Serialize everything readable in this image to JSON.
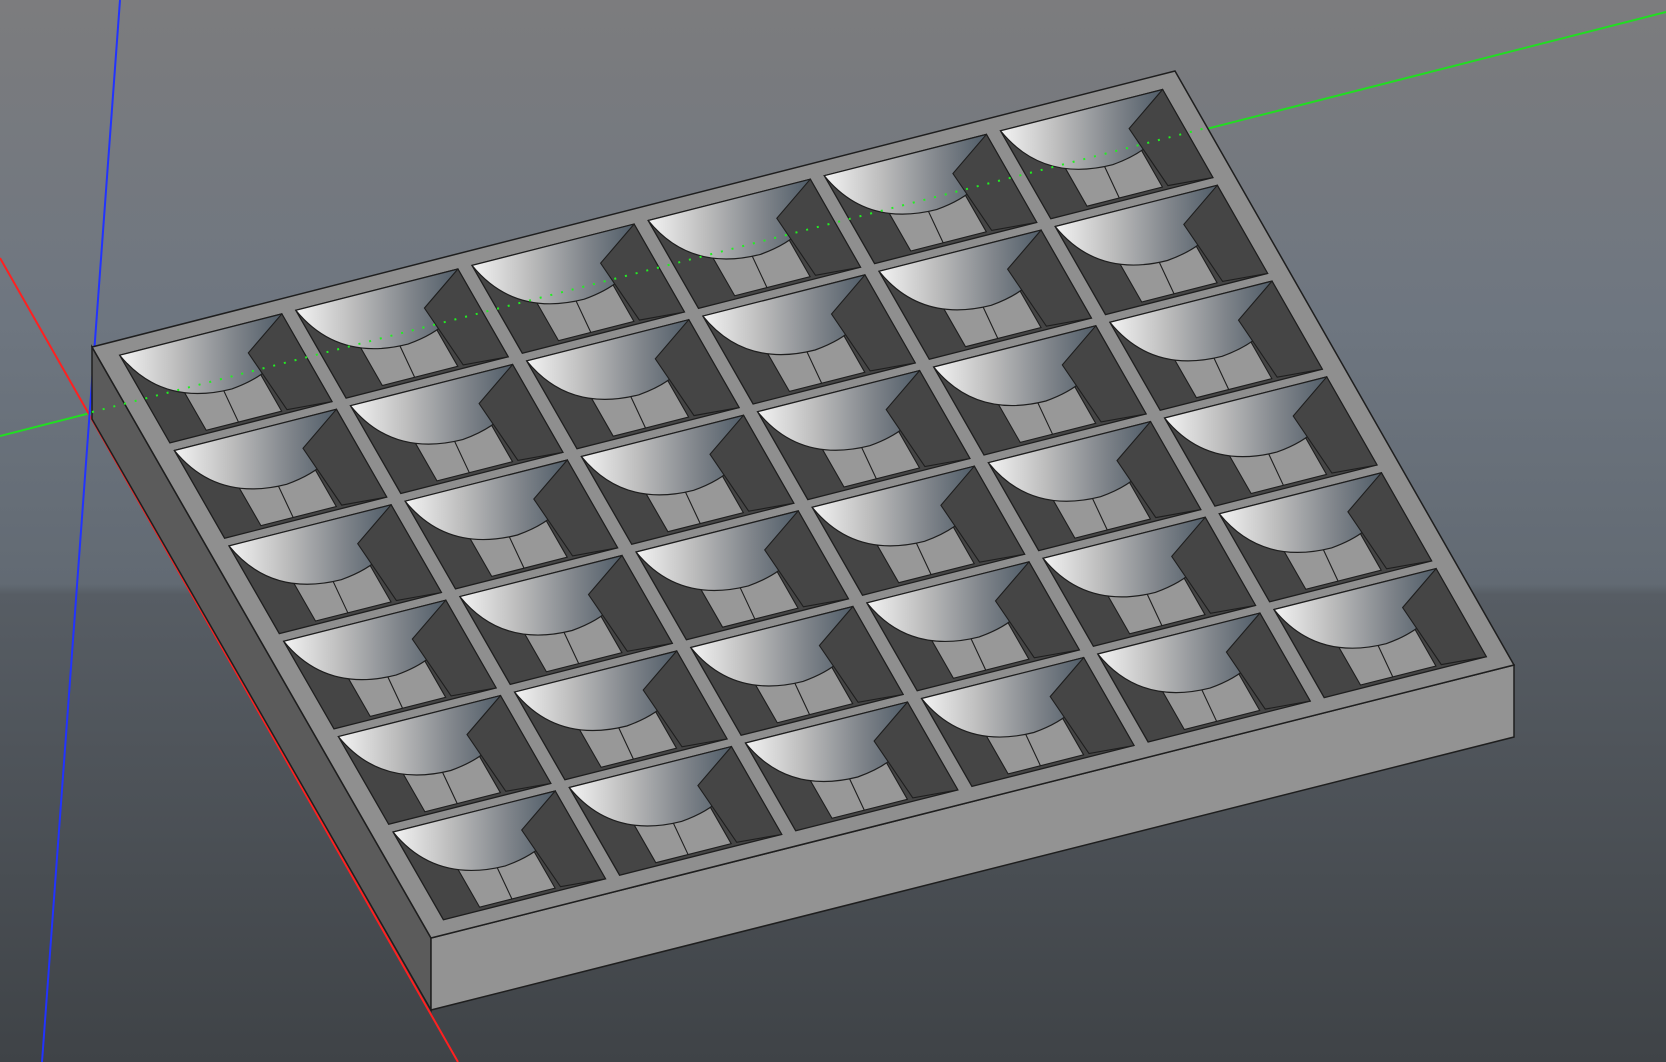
{
  "viewport": {
    "view": "3d-model-viewport",
    "background_gradient": [
      "#7b7c7e",
      "#6b7580",
      "#4b5056",
      "#3e4246"
    ],
    "axis_colors": {
      "x": "#ff2020",
      "y": "#22dd22",
      "z": "#2233ff"
    }
  },
  "model": {
    "object": "compartment-tray",
    "rows": 6,
    "columns": 6,
    "colors": {
      "rim": "#8f8f8f",
      "outer_side_front": "#939393",
      "outer_side_left": "#5b5b5b",
      "inner_wall_shadow": "#454545",
      "floor": "#989898",
      "curved_back_wall": "#909090",
      "edge_line": "#1e1e1e"
    }
  }
}
